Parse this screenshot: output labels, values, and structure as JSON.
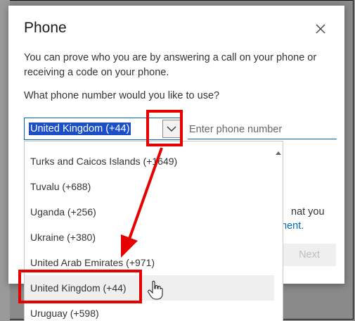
{
  "dialog": {
    "title": "Phone",
    "description": "You can prove who you are by answering a call on your phone or receiving a code on your phone.",
    "question": "What phone number would you like to use?",
    "selected_country": "United Kingdom (+44)",
    "phone_placeholder": "Enter phone number",
    "peek_text_1": "nat you",
    "peek_text_2": "ment.",
    "next_label": "Next"
  },
  "dropdown": {
    "options": [
      "Turks and Caicos Islands (+1649)",
      "Tuvalu (+688)",
      "Uganda (+256)",
      "Ukraine (+380)",
      "United Arab Emirates (+971)",
      "United Kingdom (+44)",
      "Uruguay (+598)"
    ],
    "hovered_index": 5
  },
  "colors": {
    "annotation": "#e60000",
    "accent": "#0067b8",
    "selection": "#1a4fc8"
  },
  "icons": [
    "close-icon",
    "chevron-down-icon",
    "scroll-up-icon",
    "hand-cursor-icon",
    "arrow-annotation"
  ]
}
